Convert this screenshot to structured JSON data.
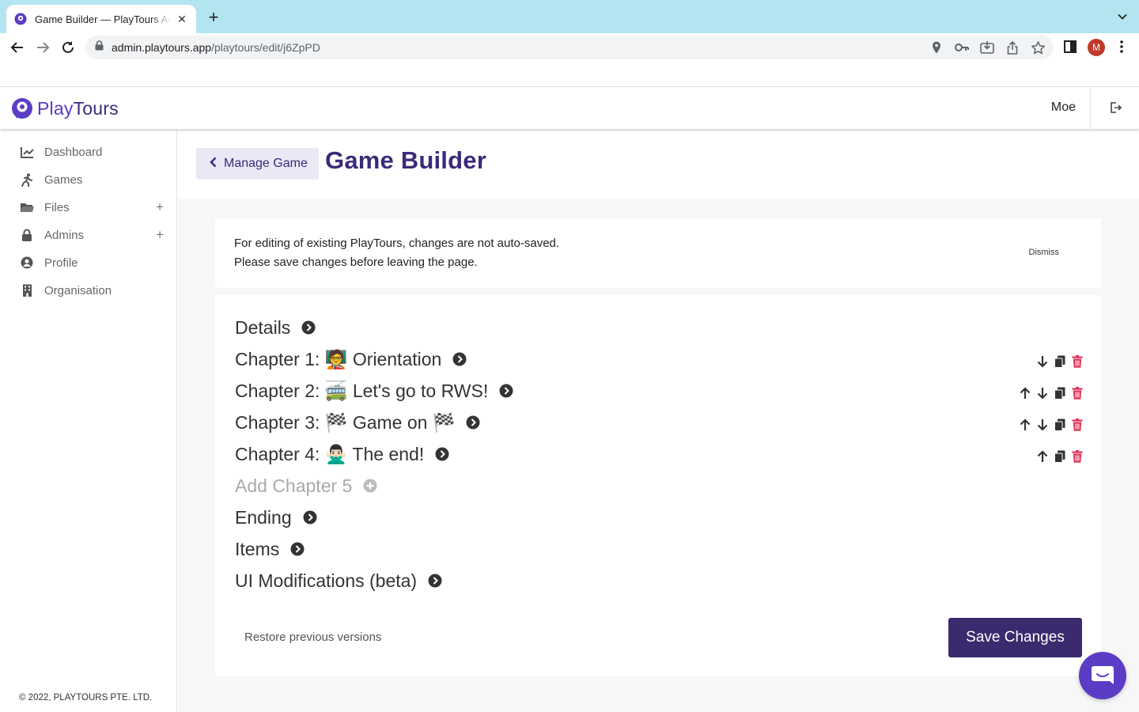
{
  "browser": {
    "tab_title": "Game Builder — PlayTours Admin",
    "url_domain": "admin.playtours.app",
    "url_path": "/playtours/edit/j6ZpPD",
    "profile_initial": "M"
  },
  "header": {
    "logo_play": "Play",
    "logo_tours": "Tours",
    "user_name": "Moe"
  },
  "sidebar": {
    "items": [
      {
        "label": "Dashboard",
        "icon": "chart-line-icon"
      },
      {
        "label": "Games",
        "icon": "running-icon"
      },
      {
        "label": "Files",
        "icon": "folder-icon",
        "has_plus": true
      },
      {
        "label": "Admins",
        "icon": "lock-icon",
        "has_plus": true
      },
      {
        "label": "Profile",
        "icon": "user-circle-icon"
      },
      {
        "label": "Organisation",
        "icon": "building-icon"
      }
    ],
    "plus_label": "+",
    "copyright": "© 2022, PLAYTOURS PTE. LTD."
  },
  "page": {
    "back_label": "Manage Game",
    "title": "Game Builder"
  },
  "notice": {
    "line1": "For editing of existing PlayTours, changes are not auto-saved.",
    "line2": "Please save changes before leaving the page.",
    "dismiss_label": "Dismiss"
  },
  "builder": {
    "sections": [
      {
        "label": "Details"
      },
      {
        "label": "Chapter 1: 🧑‍🏫 Orientation",
        "actions": [
          "down",
          "copy",
          "delete"
        ]
      },
      {
        "label": "Chapter 2: 🚎 Let's go to RWS!",
        "actions": [
          "up",
          "down",
          "copy",
          "delete"
        ]
      },
      {
        "label": "Chapter 3: 🏁 Game on 🏁",
        "actions": [
          "up",
          "down",
          "copy",
          "delete"
        ]
      },
      {
        "label": "Chapter 4: 🙅🏻‍♂️ The end!",
        "actions": [
          "up",
          "copy",
          "delete"
        ]
      },
      {
        "label": "Add Chapter 5",
        "muted": true
      },
      {
        "label": "Ending"
      },
      {
        "label": "Items"
      },
      {
        "label": "UI Modifications (beta)"
      }
    ],
    "restore_label": "Restore previous versions",
    "save_label": "Save Changes"
  },
  "colors": {
    "brand": "#5b3cc4",
    "brand_dark": "#3b2a6e",
    "delete": "#e0335a"
  }
}
